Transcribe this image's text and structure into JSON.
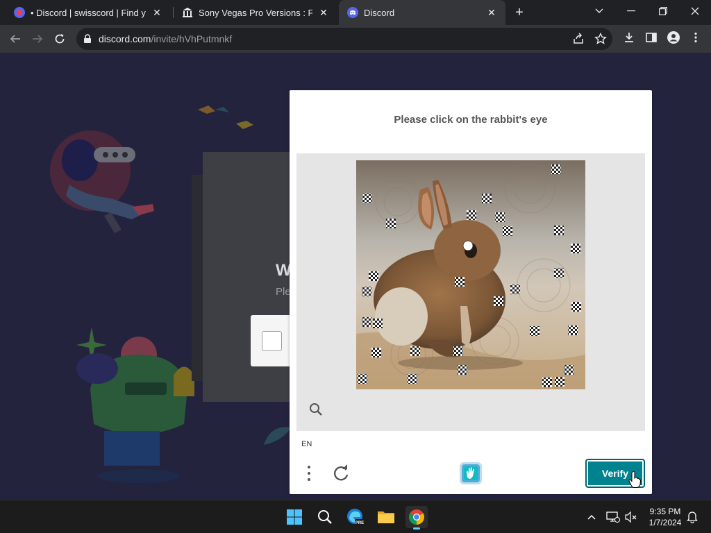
{
  "browser": {
    "tabs": [
      {
        "title": "• Discord | swisscord | Find your c",
        "favicon": "discord-red-icon",
        "active": false
      },
      {
        "title": "Sony Vegas Pro Versions : Free D",
        "favicon": "archive-building-icon",
        "active": false
      },
      {
        "title": "Discord",
        "favicon": "discord-icon",
        "active": true
      }
    ],
    "new_tab_label": "+",
    "address": {
      "domain": "discord.com",
      "path": "/invite/hVhPutmnkf"
    }
  },
  "page": {
    "heading": "W",
    "subtext": "Ple"
  },
  "captcha": {
    "prompt": "Please click on the rabbit's eye",
    "language": "EN",
    "verify_label": "Verify"
  },
  "taskbar": {
    "apps": [
      "start-icon",
      "search-icon",
      "edge-beta-icon",
      "file-explorer-icon",
      "chrome-icon"
    ],
    "time": "9:35 PM",
    "date": "1/7/2024"
  },
  "colors": {
    "page_background": "#23233d",
    "verify_button": "#00838f",
    "taskbar": "#1c1c1c"
  }
}
